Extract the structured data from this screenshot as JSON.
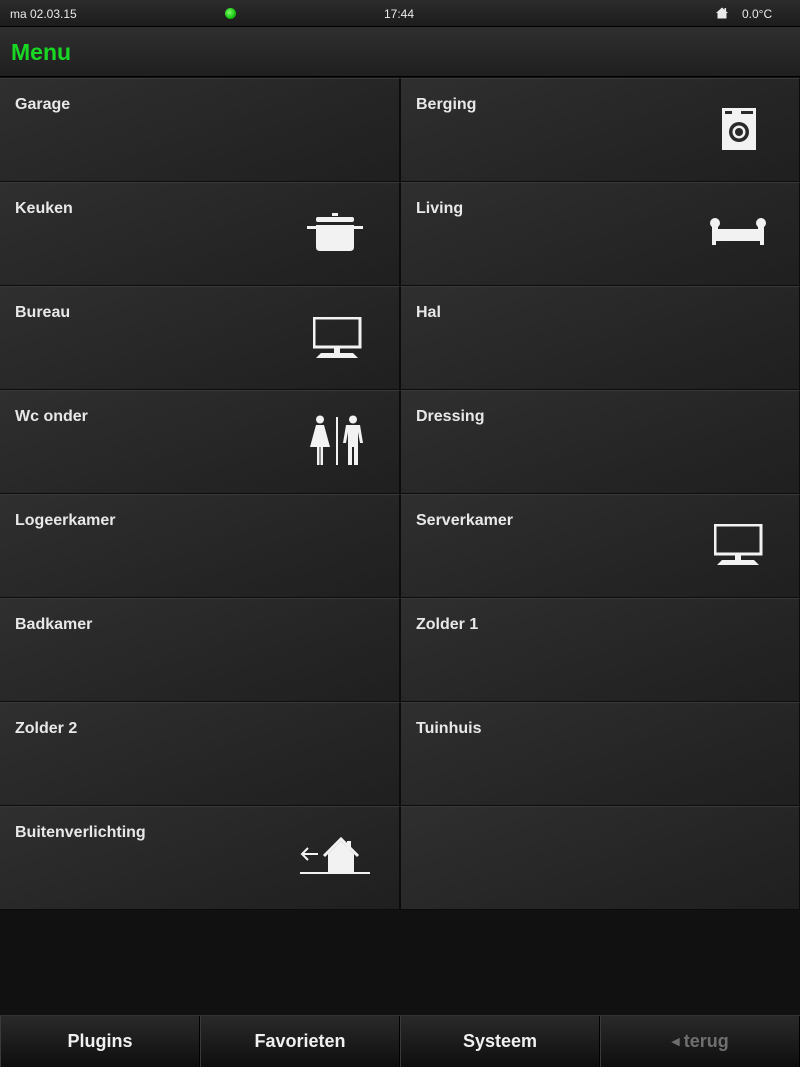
{
  "statusbar": {
    "date": "ma 02.03.15",
    "time": "17:44",
    "temperature": "0.0°C",
    "connection_color": "#19d824"
  },
  "header": {
    "title": "Menu"
  },
  "rooms": [
    {
      "label": "Garage",
      "icon": ""
    },
    {
      "label": "Berging",
      "icon": "washing-machine-icon"
    },
    {
      "label": "Keuken",
      "icon": "cooking-pot-icon"
    },
    {
      "label": "Living",
      "icon": "sofa-icon"
    },
    {
      "label": "Bureau",
      "icon": "monitor-icon"
    },
    {
      "label": "Hal",
      "icon": ""
    },
    {
      "label": "Wc onder",
      "icon": "restroom-icon"
    },
    {
      "label": "Dressing",
      "icon": ""
    },
    {
      "label": "Logeerkamer",
      "icon": ""
    },
    {
      "label": "Serverkamer",
      "icon": "monitor-icon"
    },
    {
      "label": "Badkamer",
      "icon": ""
    },
    {
      "label": "Zolder 1",
      "icon": ""
    },
    {
      "label": "Zolder 2",
      "icon": ""
    },
    {
      "label": "Tuinhuis",
      "icon": ""
    },
    {
      "label": "Buitenverlichting",
      "icon": "house-exit-icon"
    }
  ],
  "tabs": {
    "plugins": "Plugins",
    "favorites": "Favorieten",
    "system": "Systeem",
    "back": "terug"
  }
}
